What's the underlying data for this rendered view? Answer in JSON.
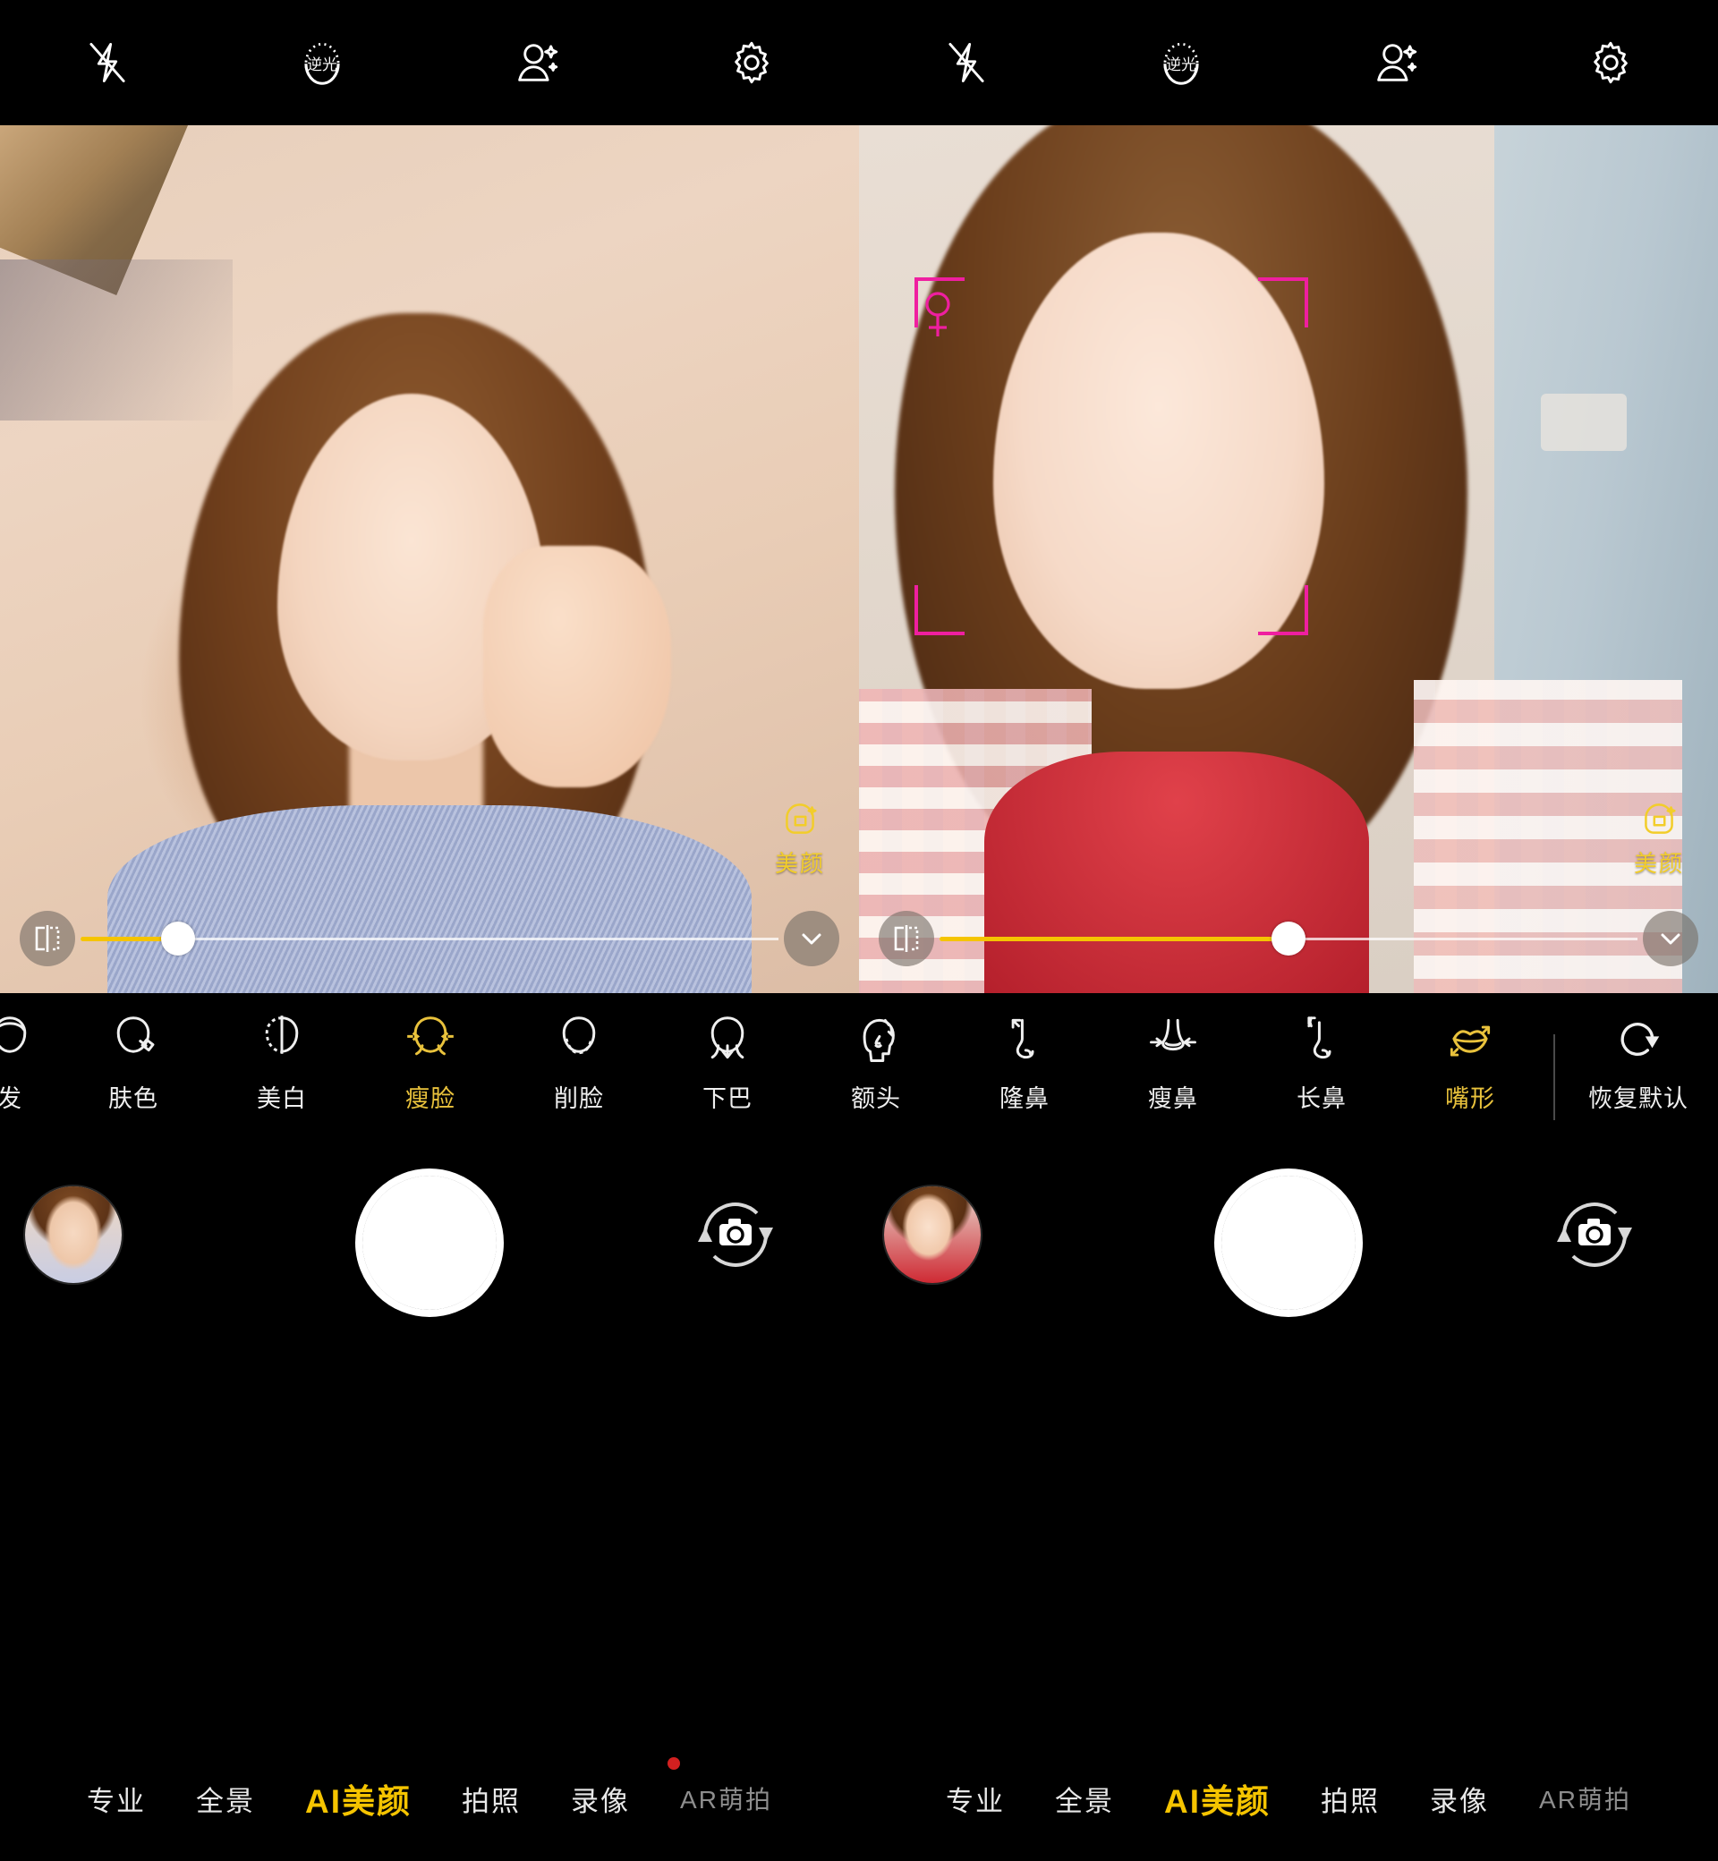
{
  "app": {
    "title": "AI Beauty Camera",
    "accent_yellow": "#f5c400",
    "label_yellow": "#e9c23c",
    "face_box_color": "#ef1fa0",
    "record_dot_color": "#d32020"
  },
  "topbar": {
    "icons": [
      {
        "name": "flash-off-icon",
        "label": "闪光灯关闭"
      },
      {
        "name": "backlight-icon",
        "label": "逆光"
      },
      {
        "name": "beauty-portrait-icon",
        "label": "人像美颜"
      },
      {
        "name": "settings-gear-icon",
        "label": "设置"
      }
    ]
  },
  "preview": {
    "left": {
      "watermark": "美颜",
      "watermark_icon": "beauty-face-icon",
      "slider": {
        "value_percent": 14,
        "aspect_icon": "aspect-ratio-icon",
        "collapse_icon": "chevron-down-icon"
      }
    },
    "right": {
      "watermark": "美颜",
      "watermark_icon": "beauty-face-icon",
      "face_detect": {
        "gender_icon": "female-symbol",
        "color": "#ef1fa0"
      },
      "slider": {
        "value_percent": 50,
        "aspect_icon": "aspect-ratio-icon",
        "collapse_icon": "chevron-down-icon"
      }
    }
  },
  "beauty_options": [
    {
      "label": "发",
      "icon": "hair-icon",
      "selected": false,
      "partial": true
    },
    {
      "label": "肤色",
      "icon": "skin-tone-icon",
      "selected": false
    },
    {
      "label": "美白",
      "icon": "whitening-icon",
      "selected": false
    },
    {
      "label": "瘦脸",
      "icon": "slim-face-icon",
      "selected": true
    },
    {
      "label": "削脸",
      "icon": "carve-face-icon",
      "selected": false
    },
    {
      "label": "下巴",
      "icon": "chin-icon",
      "selected": false
    },
    {
      "label": "额头",
      "icon": "forehead-icon",
      "selected": false
    },
    {
      "label": "隆鼻",
      "icon": "nose-bridge-icon",
      "selected": false
    },
    {
      "label": "瘦鼻",
      "icon": "slim-nose-icon",
      "selected": false
    },
    {
      "label": "长鼻",
      "icon": "long-nose-icon",
      "selected": false
    },
    {
      "label": "嘴形",
      "icon": "lips-shape-icon",
      "selected": true
    },
    {
      "label": "恢复默认",
      "icon": "reset-icon",
      "selected": false
    }
  ],
  "shutter": {
    "left": {
      "thumbnail": "last-photo-thumbnail",
      "capture_label": "拍摄",
      "flip_icon": "switch-camera-icon"
    },
    "right": {
      "thumbnail": "last-photo-thumbnail",
      "capture_label": "拍摄",
      "flip_icon": "switch-camera-icon"
    }
  },
  "modes": {
    "left": [
      {
        "label": "专业",
        "state": "normal"
      },
      {
        "label": "全景",
        "state": "normal"
      },
      {
        "label": "AI美颜",
        "state": "selected"
      },
      {
        "label": "拍照",
        "state": "normal"
      },
      {
        "label": "录像",
        "state": "normal"
      },
      {
        "label": "AR萌拍",
        "state": "dim"
      }
    ],
    "right": [
      {
        "label": "专业",
        "state": "normal"
      },
      {
        "label": "全景",
        "state": "normal"
      },
      {
        "label": "AI美颜",
        "state": "selected"
      },
      {
        "label": "拍照",
        "state": "normal"
      },
      {
        "label": "录像",
        "state": "normal"
      },
      {
        "label": "AR萌拍",
        "state": "dim"
      }
    ]
  }
}
